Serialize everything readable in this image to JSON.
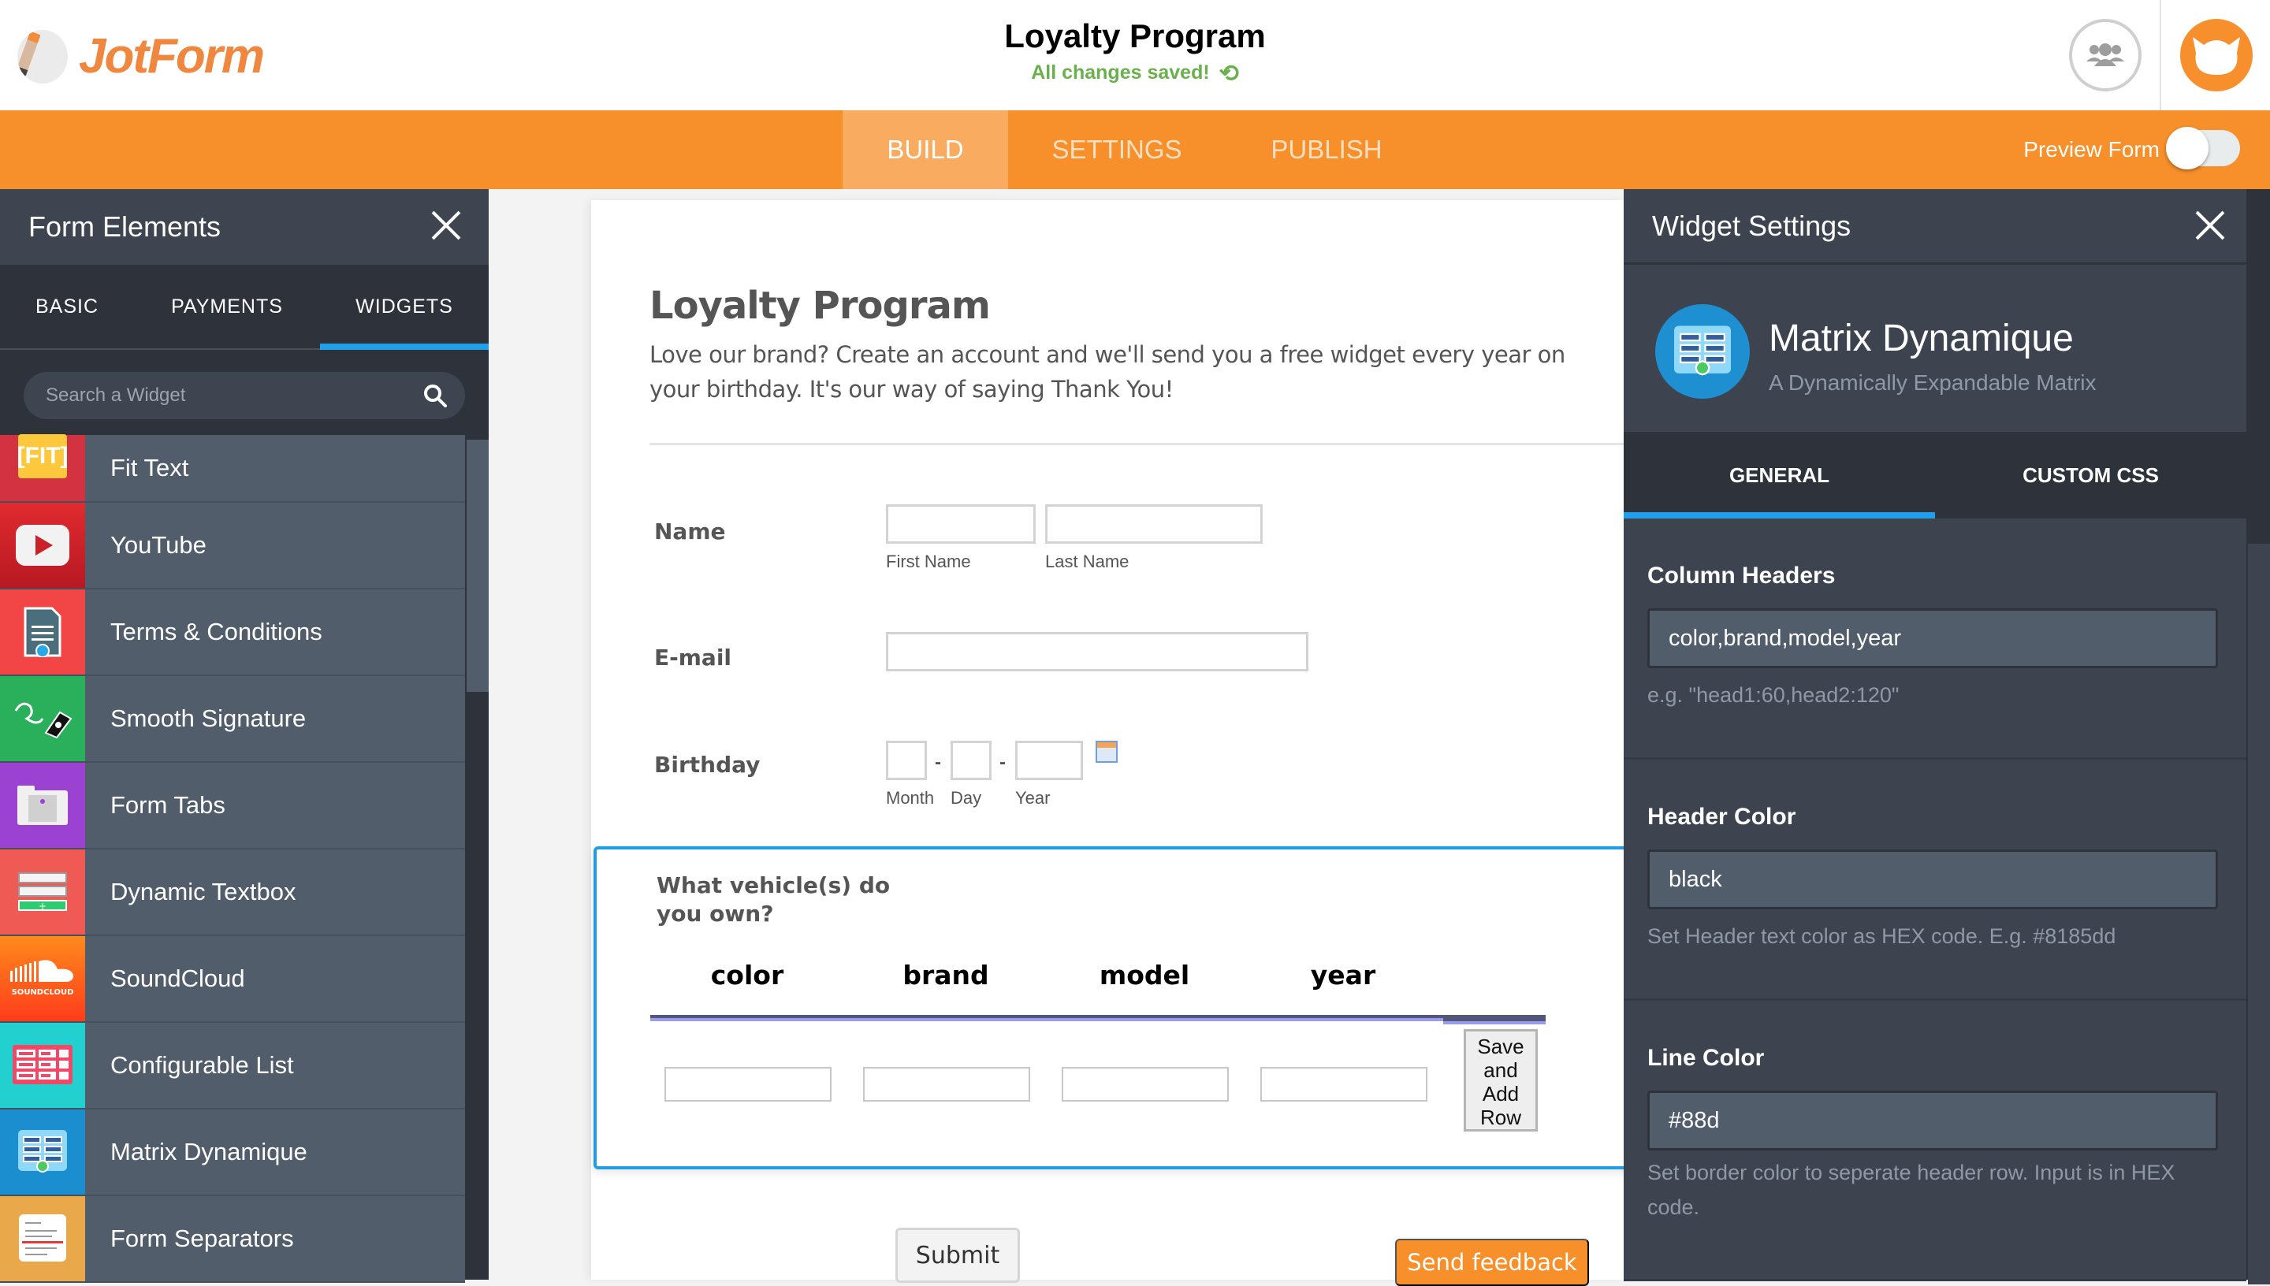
{
  "app": {
    "brand": "JotForm",
    "document_title": "Loyalty Program",
    "save_status": "All changes saved!",
    "accent_color": "#f7902a",
    "active_tab_color": "#1fa0e8"
  },
  "nav": {
    "tabs": [
      {
        "label": "BUILD",
        "active": true
      },
      {
        "label": "SETTINGS",
        "active": false
      },
      {
        "label": "PUBLISH",
        "active": false
      }
    ],
    "preview_label": "Preview Form",
    "preview_enabled": false
  },
  "left_panel": {
    "title": "Form Elements",
    "tabs": [
      {
        "label": "BASIC",
        "active": false
      },
      {
        "label": "PAYMENTS",
        "active": false
      },
      {
        "label": "WIDGETS",
        "active": true
      }
    ],
    "search_placeholder": "Search a Widget",
    "widgets": [
      {
        "label": "Fit Text",
        "icon": "fit-text-icon",
        "color": "#d33241"
      },
      {
        "label": "YouTube",
        "icon": "youtube-icon",
        "color": "#c9202a"
      },
      {
        "label": "Terms & Conditions",
        "icon": "terms-document-icon",
        "color": "#f24646"
      },
      {
        "label": "Smooth Signature",
        "icon": "signature-pen-icon",
        "color": "#2ab05a"
      },
      {
        "label": "Form Tabs",
        "icon": "form-tabs-icon",
        "color": "#9b42d3"
      },
      {
        "label": "Dynamic Textbox",
        "icon": "dynamic-textbox-icon",
        "color": "#f05a55"
      },
      {
        "label": "SoundCloud",
        "icon": "soundcloud-icon",
        "color": "#ff5a1f"
      },
      {
        "label": "Configurable List",
        "icon": "configurable-list-icon",
        "color": "#22d1cf"
      },
      {
        "label": "Matrix Dynamique",
        "icon": "matrix-icon",
        "color": "#1a8ecf"
      },
      {
        "label": "Form Separators",
        "icon": "form-separators-icon",
        "color": "#e9a94b"
      }
    ]
  },
  "form": {
    "title": "Loyalty Program",
    "description": "Love our brand? Create an account and we'll send you a free widget every year on your birthday. It's our way of saying Thank You!",
    "fields": {
      "name": {
        "label": "Name",
        "first_sublabel": "First Name",
        "last_sublabel": "Last Name",
        "first_value": "",
        "last_value": ""
      },
      "email": {
        "label": "E-mail",
        "value": ""
      },
      "birthday": {
        "label": "Birthday",
        "month_sublabel": "Month",
        "day_sublabel": "Day",
        "year_sublabel": "Year",
        "separator": "-"
      }
    },
    "matrix": {
      "question": "What vehicle(s) do you own?",
      "columns": [
        "color",
        "brand",
        "model",
        "year"
      ],
      "add_row_label": "Save and Add Row"
    },
    "submit_label": "Submit",
    "feedback_label": "Send feedback"
  },
  "right_panel": {
    "title": "Widget Settings",
    "widget_name": "Matrix Dynamique",
    "widget_description": "A Dynamically Expandable Matrix",
    "tabs": [
      {
        "label": "GENERAL",
        "active": true
      },
      {
        "label": "CUSTOM CSS",
        "active": false
      }
    ],
    "settings": [
      {
        "label": "Column Headers",
        "value": "color,brand,model,year",
        "hint": "e.g. \"head1:60,head2:120\""
      },
      {
        "label": "Header Color",
        "value": "black",
        "hint": "Set Header text color as HEX code. E.g. #8185dd"
      },
      {
        "label": "Line Color",
        "value": "#88d",
        "hint": "Set border color to seperate header row. Input is in HEX code."
      }
    ]
  }
}
